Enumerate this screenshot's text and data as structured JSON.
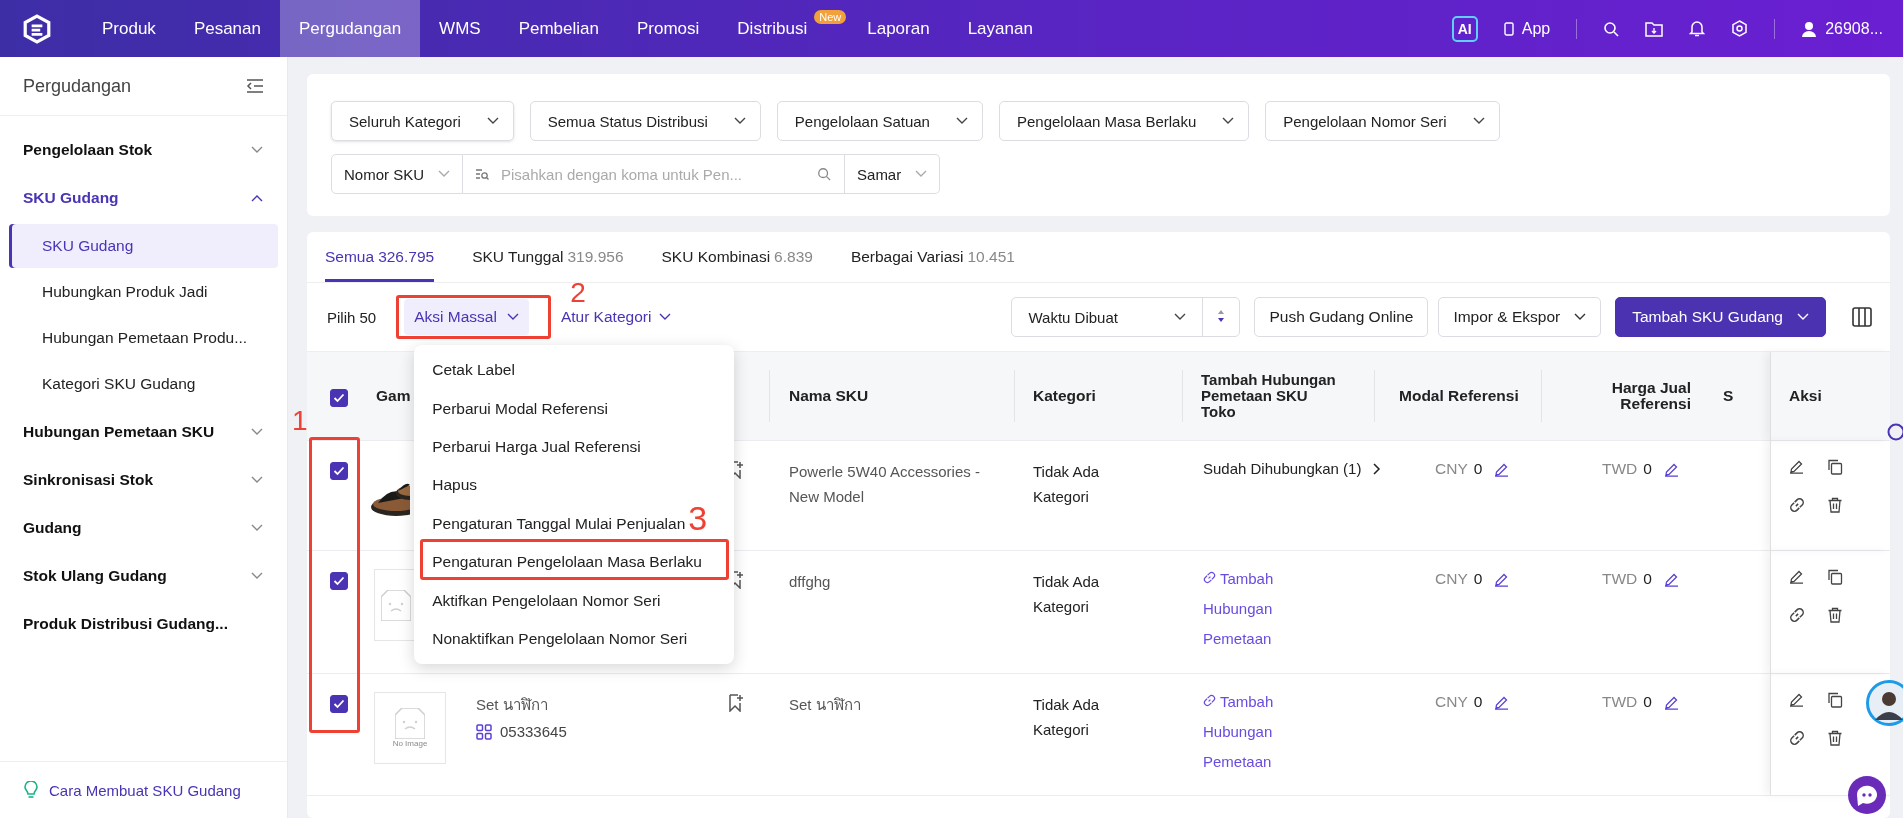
{
  "topbar": {
    "nav": [
      {
        "label": "Produk",
        "selected": false
      },
      {
        "label": "Pesanan",
        "selected": false
      },
      {
        "label": "Pergudangan",
        "selected": true
      },
      {
        "label": "WMS",
        "selected": false
      },
      {
        "label": "Pembelian",
        "selected": false
      },
      {
        "label": "Promosi",
        "selected": false
      },
      {
        "label": "Distribusi",
        "selected": false,
        "badge": "New"
      },
      {
        "label": "Laporan",
        "selected": false
      },
      {
        "label": "Layanan",
        "selected": false
      }
    ],
    "ai": "AI",
    "app": "App",
    "user": "26908..."
  },
  "sidebar": {
    "title": "Pergudangan",
    "items": [
      {
        "kind": "group",
        "label": "Pengelolaan Stok",
        "expanded": false,
        "selected": false
      },
      {
        "kind": "group",
        "label": "SKU Gudang",
        "expanded": true,
        "selected": true,
        "children": [
          {
            "label": "SKU Gudang",
            "selected": true
          },
          {
            "label": "Hubungkan Produk Jadi",
            "selected": false
          },
          {
            "label": "Hubungan Pemetaan Produ...",
            "selected": false
          },
          {
            "label": "Kategori SKU Gudang",
            "selected": false
          }
        ]
      },
      {
        "kind": "group",
        "label": "Hubungan Pemetaan SKU",
        "expanded": false,
        "selected": false
      },
      {
        "kind": "group",
        "label": "Sinkronisasi Stok",
        "expanded": false,
        "selected": false
      },
      {
        "kind": "group",
        "label": "Gudang",
        "expanded": false,
        "selected": false
      },
      {
        "kind": "group",
        "label": "Stok Ulang Gudang",
        "expanded": false,
        "selected": false
      },
      {
        "kind": "link",
        "label": "Produk Distribusi Gudang...",
        "selected": false
      }
    ],
    "help_link": "Cara Membuat SKU Gudang"
  },
  "filters_row_1": [
    {
      "kind": "select",
      "label": "Seluruh Kategori"
    },
    {
      "kind": "select",
      "label": "Semua Status Distribusi"
    },
    {
      "kind": "select",
      "label": "Pengelolaan Satuan"
    },
    {
      "kind": "select",
      "label": "Pengelolaan Masa Berlaku"
    },
    {
      "kind": "select",
      "label": "Pengelolaan Nomor Seri"
    }
  ],
  "filters_row_2": [
    {
      "kind": "select",
      "label": "Nomor SKU"
    },
    {
      "kind": "search",
      "placeholder": "Pisahkan dengan koma untuk Pen..."
    },
    {
      "kind": "select",
      "label": "Samar"
    }
  ],
  "tabs": [
    {
      "label": "Semua",
      "count": "326.795",
      "selected": true
    },
    {
      "label": "SKU Tunggal",
      "count": "319.956",
      "selected": false
    },
    {
      "label": "SKU Kombinasi",
      "count": "6.839",
      "selected": false
    },
    {
      "label": "Berbagai Variasi",
      "count": "10.451",
      "selected": false
    }
  ],
  "toolbar": {
    "selection": "Pilih 50",
    "bulk_action": {
      "label": "Aksi Massal",
      "expanded": true
    },
    "set_category": "Atur Kategori",
    "sort": "Waktu Dibuat",
    "buttons": [
      {
        "kind": "plain",
        "label": "Push Gudang Online"
      },
      {
        "kind": "dropdown",
        "label": "Impor & Ekspor"
      },
      {
        "kind": "primary",
        "label": "Tambah SKU Gudang"
      }
    ]
  },
  "bulk_menu": [
    "Cetak Label",
    "Perbarui Modal Referensi",
    "Perbarui Harga Jual Referensi",
    "Hapus",
    "Pengaturan Tanggal Mulai Penjualan",
    "Pengaturan Pengelolaan Masa Berlaku",
    "Aktifkan Pengelolaan Nomor Seri",
    "Nonaktifkan Pengelolaan Nomor Seri"
  ],
  "table": {
    "all_checked": true,
    "columns": {
      "image": "Gam",
      "name": "Nama SKU",
      "category": "Kategori",
      "mapping": "Tambah Hubungan Pemetaan SKU Toko",
      "cost": "Modal Referensi",
      "price": "Harga Jual Referensi",
      "column_9": "S",
      "actions": "Aksi"
    },
    "rows": [
      {
        "checked": true,
        "name": "Powerle 5W40 Accessories - New Model",
        "category": "Tidak Ada Kategori",
        "mapping": {
          "kind": "linked",
          "text": "Sudah Dihubungkan (1)"
        },
        "cost_currency": "CNY",
        "cost": "0",
        "price_currency": "TWD",
        "price": "0"
      },
      {
        "checked": true,
        "image": {
          "kind": "placeholder"
        },
        "name": "dffghg",
        "category": "Tidak Ada Kategori",
        "mapping": {
          "kind": "add",
          "text": "Tambah Hubungan Pemetaan"
        },
        "cost_currency": "CNY",
        "cost": "0",
        "price_currency": "TWD",
        "price": "0"
      },
      {
        "checked": true,
        "image": {
          "kind": "placeholder",
          "text": "No Image"
        },
        "sku_name": "Set นาฬิกา",
        "sku_code": "05333645",
        "name": "Set นาฬิกา",
        "category": "Tidak Ada Kategori",
        "mapping": {
          "kind": "add",
          "text": "Tambah Hubungan Pemetaan"
        },
        "cost_currency": "CNY",
        "cost": "0",
        "price_currency": "TWD",
        "price": "0"
      }
    ]
  },
  "annotations": [
    "1",
    "2",
    "3"
  ]
}
